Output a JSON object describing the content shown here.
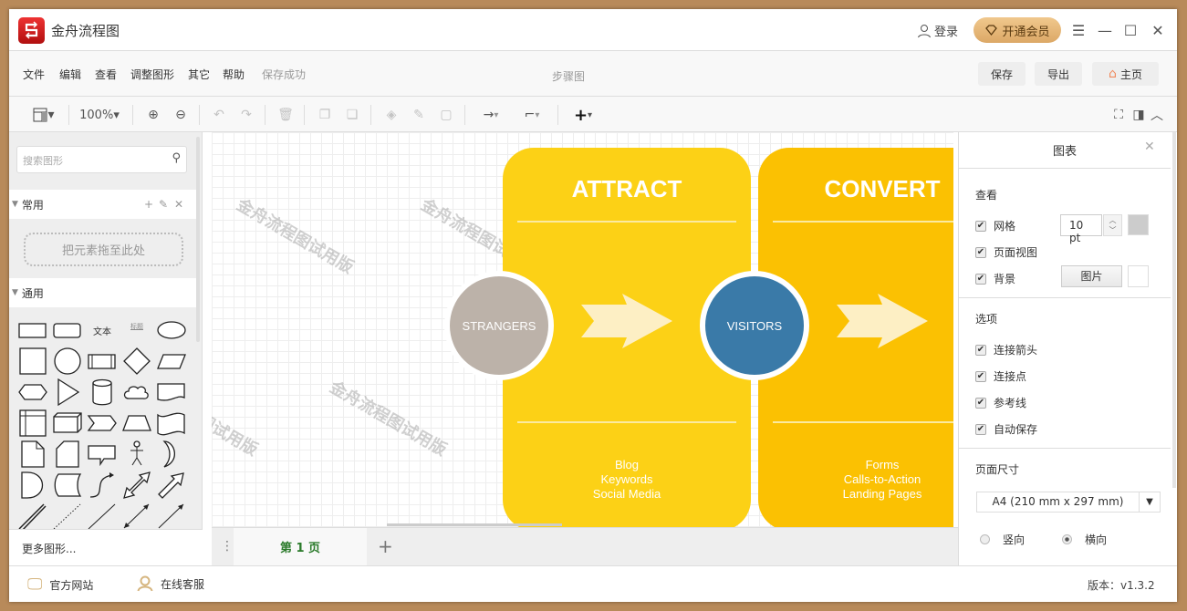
{
  "app": {
    "title": "金舟流程图",
    "login": "登录",
    "vip": "开通会员"
  },
  "menu": {
    "items": [
      "文件",
      "编辑",
      "查看",
      "调整图形",
      "其它",
      "帮助"
    ],
    "status": "保存成功",
    "doc_title": "步骤图",
    "save": "保存",
    "export": "导出",
    "home": "主页"
  },
  "toolbar": {
    "zoom": "100%"
  },
  "sidebar": {
    "search_placeholder": "搜索图形",
    "common": "常用",
    "drop_hint": "把元素拖至此处",
    "general": "通用",
    "text_shape": "文本",
    "heading_shape": "标题",
    "more_shapes": "更多图形...",
    "shapes": [
      "rectangle",
      "rounded-rectangle",
      "text",
      "heading",
      "ellipse",
      "square",
      "circle",
      "process",
      "diamond",
      "parallelogram",
      "hexagon",
      "triangle",
      "cylinder",
      "cloud",
      "document",
      "internal-storage",
      "cube",
      "step",
      "trapezoid",
      "tape",
      "note",
      "card",
      "callout",
      "actor",
      "or",
      "delay",
      "data-storage",
      "curved-arrow",
      "bidirectional-arrow",
      "arrow",
      "double-line",
      "dotted-line",
      "line",
      "bidirectional-connector",
      "directional-connector"
    ]
  },
  "canvas": {
    "watermark": "金舟流程图试用版",
    "cards": [
      {
        "title": "ATTRACT",
        "items": [
          "Blog",
          "Keywords",
          "Social Media"
        ],
        "color": "#fcd116"
      },
      {
        "title": "CONVERT",
        "items": [
          "Forms",
          "Calls-to-Action",
          "Landing Pages"
        ],
        "color": "#fbc102"
      }
    ],
    "circles": [
      {
        "label": "STRANGERS",
        "color": "#bcb2a9"
      },
      {
        "label": "VISITORS",
        "color": "#3a7aa8"
      }
    ]
  },
  "pages": {
    "current": "第 1 页"
  },
  "panel": {
    "title": "图表",
    "view": "查看",
    "grid": "网格",
    "grid_size": "10 pt",
    "page_view": "页面视图",
    "background": "背景",
    "image_btn": "图片",
    "options": "选项",
    "connect_arrows": "连接箭头",
    "connect_points": "连接点",
    "guides": "参考线",
    "autosave": "自动保存",
    "page_size": "页面尺寸",
    "page_size_value": "A4 (210 mm x 297 mm)",
    "portrait": "竖向",
    "landscape": "横向",
    "orientation_selected": "landscape"
  },
  "footer": {
    "website": "官方网站",
    "support": "在线客服",
    "version": "版本：v1.3.2"
  }
}
